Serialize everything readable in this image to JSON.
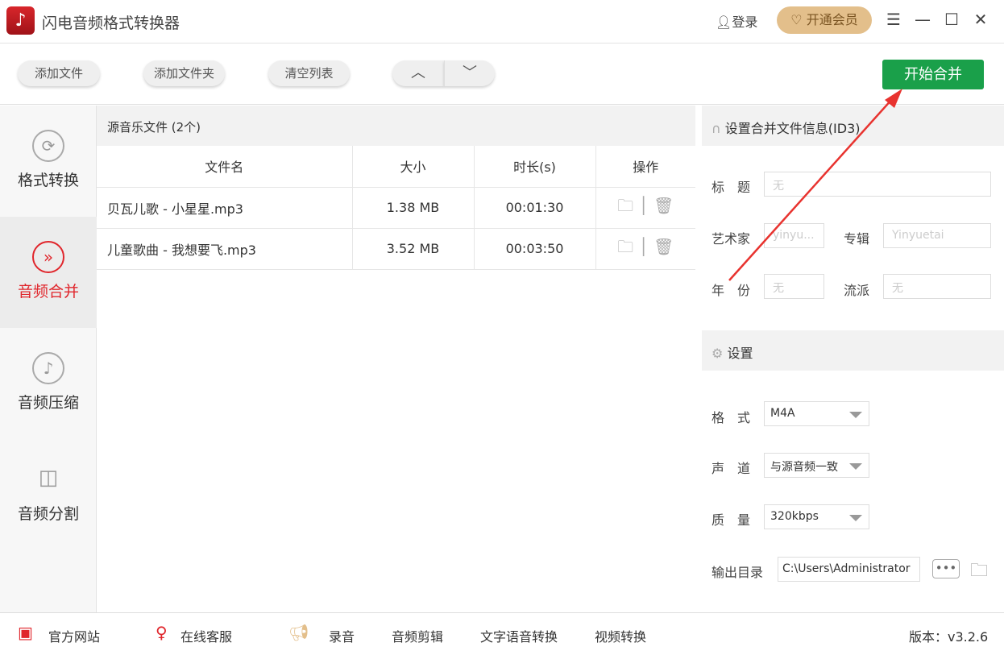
{
  "app": {
    "title": "闪电音频格式转换器",
    "login": "登录",
    "vip": "开通会员"
  },
  "toolbar": {
    "add_file": "添加文件",
    "add_folder": "添加文件夹",
    "clear_list": "清空列表",
    "start": "开始合并"
  },
  "sidebar": {
    "items": [
      {
        "label": "格式转换",
        "icon": "refresh-icon"
      },
      {
        "label": "音频合并",
        "icon": "merge-icon",
        "selected": true
      },
      {
        "label": "音频压缩",
        "icon": "music-note-icon"
      },
      {
        "label": "音频分割",
        "icon": "split-icon"
      }
    ]
  },
  "main": {
    "header": "源音乐文件 (2个)",
    "columns": [
      "文件名",
      "大小",
      "时长(s)",
      "操作"
    ],
    "rows": [
      {
        "name": "贝瓦儿歌 - 小星星.mp3",
        "size": "1.38 MB",
        "duration": "00:01:30"
      },
      {
        "name": "儿童歌曲 - 我想要飞.mp3",
        "size": "3.52 MB",
        "duration": "00:03:50"
      }
    ]
  },
  "id3": {
    "header": "设置合并文件信息(ID3)",
    "title_label": "标　题",
    "title_value": "无",
    "artist_label": "艺术家",
    "artist_value": "yinyu...",
    "album_label": "专辑",
    "album_value": "Yinyuetai",
    "year_label": "年　份",
    "year_value": "无",
    "genre_label": "流派",
    "genre_value": "无"
  },
  "settings": {
    "header": "设置",
    "format_label": "格　式",
    "format_value": "M4A",
    "channel_label": "声　道",
    "channel_value": "与源音频一致",
    "quality_label": "质　量",
    "quality_value": "320kbps",
    "output_label": "输出目录",
    "output_value": "C:\\Users\\Administrator"
  },
  "footer": {
    "website": "官方网站",
    "support": "在线客服",
    "record": "录音",
    "edit": "音频剪辑",
    "tts": "文字语音转换",
    "video": "视频转换",
    "version": "版本：v3.2.6"
  },
  "colors": {
    "accent": "#e0262c",
    "start": "#1aa04a",
    "vip": "#e3bf8b"
  }
}
